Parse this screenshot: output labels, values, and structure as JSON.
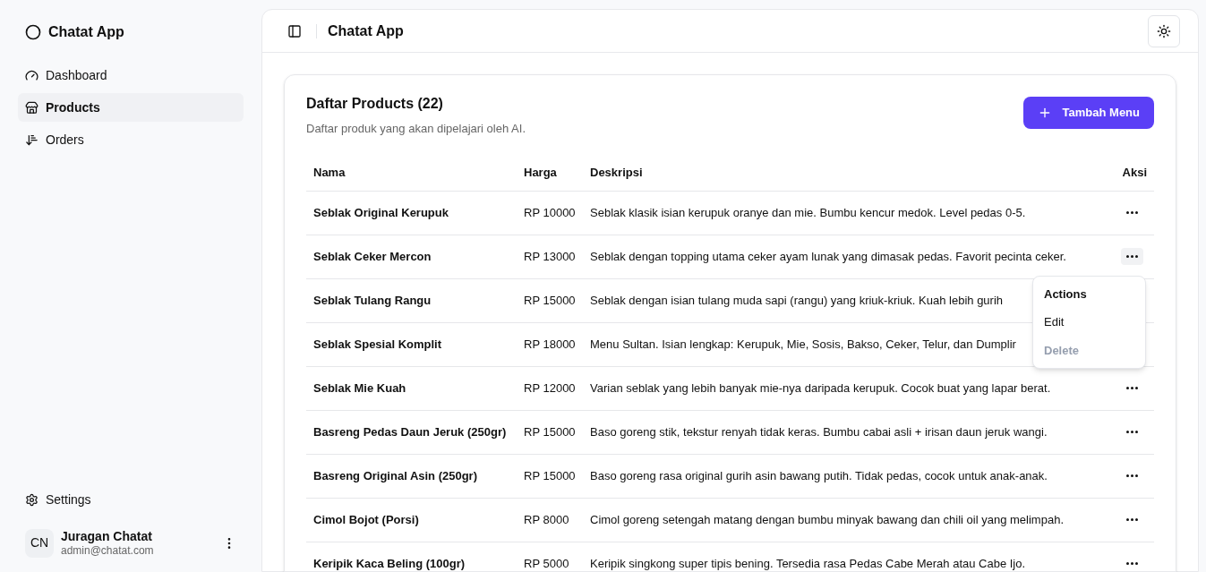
{
  "sidebar": {
    "app_name": "Chatat App",
    "items": [
      {
        "label": "Dashboard",
        "selected": false
      },
      {
        "label": "Products",
        "selected": true
      },
      {
        "label": "Orders",
        "selected": false
      }
    ],
    "footer_item": {
      "label": "Settings"
    },
    "user": {
      "initials": "CN",
      "name": "Juragan Chatat",
      "email": "admin@chatat.com"
    }
  },
  "header": {
    "title": "Chatat App"
  },
  "card": {
    "title": "Daftar Products (22)",
    "subtitle": "Daftar produk yang akan dipelajari oleh AI.",
    "add_button": "Tambah Menu"
  },
  "table": {
    "columns": [
      "Nama",
      "Harga",
      "Deskripsi",
      "Aksi"
    ],
    "rows": [
      {
        "name": "Seblak Original Kerupuk",
        "price": "RP 10000",
        "description": "Seblak klasik isian kerupuk oranye dan mie. Bumbu kencur medok. Level pedas 0-5."
      },
      {
        "name": "Seblak Ceker Mercon",
        "price": "RP 13000",
        "description": "Seblak dengan topping utama ceker ayam lunak yang dimasak pedas. Favorit pecinta ceker.",
        "actions_menu": {
          "items": [
            {
              "kind": "label",
              "label": "Actions"
            },
            {
              "kind": "item",
              "label": "Edit",
              "disabled": false
            },
            {
              "kind": "item",
              "label": "Delete",
              "disabled": true
            }
          ]
        }
      },
      {
        "name": "Seblak Tulang Rangu",
        "price": "RP 15000",
        "description": "Seblak dengan isian tulang muda sapi (rangu) yang kriuk-kriuk. Kuah lebih gurih"
      },
      {
        "name": "Seblak Spesial Komplit",
        "price": "RP 18000",
        "description": "Menu Sultan. Isian lengkap: Kerupuk, Mie, Sosis, Bakso, Ceker, Telur, dan Dumplir"
      },
      {
        "name": "Seblak Mie Kuah",
        "price": "RP 12000",
        "description": "Varian seblak yang lebih banyak mie-nya daripada kerupuk. Cocok buat yang lapar berat."
      },
      {
        "name": "Basreng Pedas Daun Jeruk (250gr)",
        "price": "RP 15000",
        "description": "Baso goreng stik, tekstur renyah tidak keras. Bumbu cabai asli + irisan daun jeruk wangi."
      },
      {
        "name": "Basreng Original Asin (250gr)",
        "price": "RP 15000",
        "description": "Baso goreng rasa original gurih asin bawang putih. Tidak pedas, cocok untuk anak-anak."
      },
      {
        "name": "Cimol Bojot (Porsi)",
        "price": "RP 8000",
        "description": "Cimol goreng setengah matang dengan bumbu minyak bawang dan chili oil yang melimpah."
      },
      {
        "name": "Keripik Kaca Beling (100gr)",
        "price": "RP 5000",
        "description": "Keripik singkong super tipis bening. Tersedia rasa Pedas Cabe Merah atau Cabe Ijo."
      }
    ]
  }
}
